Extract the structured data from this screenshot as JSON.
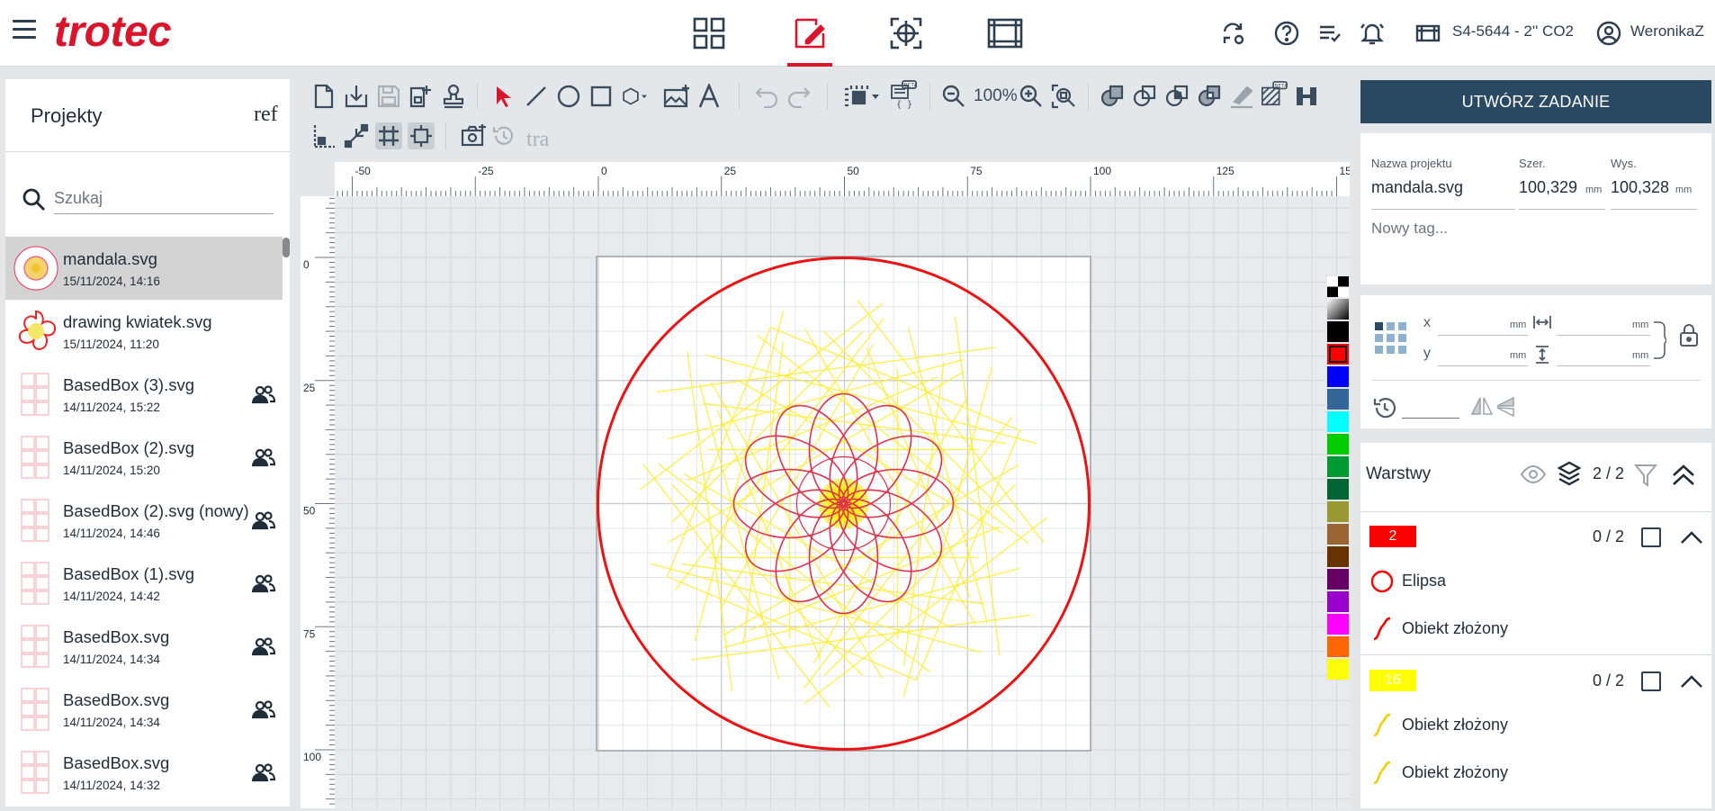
{
  "header": {
    "logo": "trotec",
    "nav": [
      "dashboard",
      "design",
      "position",
      "jobs"
    ],
    "device": "S4-5644 - 2'' CO2",
    "user": "WeronikaZ"
  },
  "left": {
    "title": "Projekty",
    "ref_text": "ref",
    "search_placeholder": "Szukaj",
    "files": [
      {
        "name": "mandala.svg",
        "date": "15/11/2024, 14:16",
        "shared": false,
        "selected": true
      },
      {
        "name": "drawing kwiatek.svg",
        "date": "15/11/2024, 11:20",
        "shared": false
      },
      {
        "name": "BasedBox (3).svg",
        "date": "14/11/2024, 15:22",
        "shared": true
      },
      {
        "name": "BasedBox (2).svg",
        "date": "14/11/2024, 15:20",
        "shared": true
      },
      {
        "name": "BasedBox (2).svg (nowy)",
        "date": "14/11/2024, 14:46",
        "shared": true
      },
      {
        "name": "BasedBox (1).svg",
        "date": "14/11/2024, 14:42",
        "shared": true
      },
      {
        "name": "BasedBox.svg",
        "date": "14/11/2024, 14:34",
        "shared": true
      },
      {
        "name": "BasedBox.svg",
        "date": "14/11/2024, 14:34",
        "shared": true
      },
      {
        "name": "BasedBox.svg",
        "date": "14/11/2024, 14:32",
        "shared": true
      }
    ]
  },
  "toolbar": {
    "zoom": "100%",
    "tra_text": "tra"
  },
  "rulers": {
    "h_labels": [
      "-50",
      "-25",
      "0",
      "25",
      "50",
      "75",
      "100",
      "125",
      "15"
    ],
    "v_labels": [
      "0",
      "25",
      "50",
      "75",
      "100"
    ]
  },
  "palette": [
    "#000000",
    "#ff0000",
    "#0000ff",
    "#336699",
    "#00ffff",
    "#00cc00",
    "#009933",
    "#006633",
    "#999933",
    "#996633",
    "#663300",
    "#660066",
    "#9900cc",
    "#ff00ff",
    "#ff6600",
    "#ffff00"
  ],
  "right": {
    "create_button": "UTWÓRZ ZADANIE",
    "project_name_label": "Nazwa projektu",
    "project_name": "mandala.svg",
    "width_label": "Szer.",
    "width": "100,329",
    "height_label": "Wys.",
    "height": "100,328",
    "unit": "mm",
    "tag_placeholder": "Nowy tag...",
    "x_label": "x",
    "y_label": "y",
    "layers_title": "Warstwy",
    "layers_count": "2 / 2",
    "layers": [
      {
        "badge": "2",
        "color": "#ff0000",
        "count": "0 / 2",
        "objects": [
          "Elipsa",
          "Obiekt złożony"
        ]
      },
      {
        "badge": "16",
        "color": "#ffff00",
        "count": "0 / 2",
        "objects": [
          "Obiekt złożony",
          "Obiekt złożony"
        ]
      }
    ]
  }
}
